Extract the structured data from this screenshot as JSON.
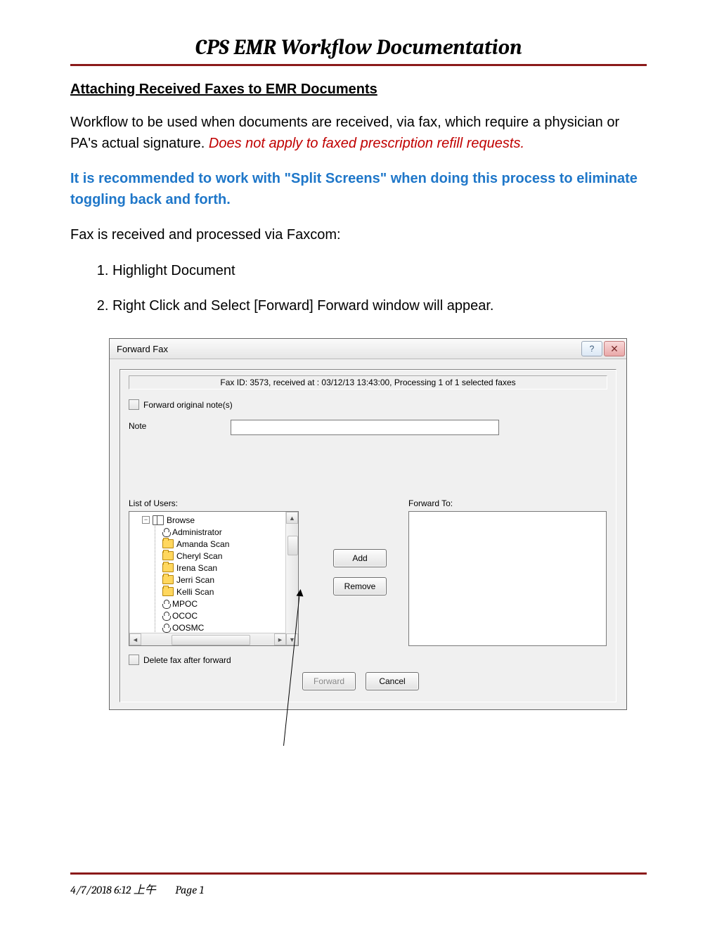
{
  "header": {
    "title": "CPS EMR Workflow Documentation"
  },
  "section": {
    "heading": "Attaching Received Faxes to EMR Documents"
  },
  "para1": {
    "lead": "Workflow to be used when documents are received, via fax, which require a physician or PA's actual signature. ",
    "warn": "Does not apply to faxed prescription refill requests."
  },
  "para2": "It is recommended to work with \"Split Screens\" when doing this process to eliminate toggling back and forth.",
  "para3": "Fax is received and processed via Faxcom:",
  "steps": [
    "Highlight Document",
    "Right Click and Select [Forward] Forward window will appear."
  ],
  "dialog": {
    "title": "Forward Fax",
    "help_glyph": "?",
    "close_glyph": "✕",
    "fax_id_line": "Fax ID: 3573, received at : 03/12/13 13:43:00, Processing  1 of 1 selected faxes",
    "forward_original_label": "Forward original note(s)",
    "note_label": "Note",
    "list_of_users_label": "List of Users:",
    "forward_to_label": "Forward To:",
    "tree_root": "Browse",
    "tree_items": [
      {
        "label": "Administrator",
        "icon": "user"
      },
      {
        "label": "Amanda Scan",
        "icon": "folder"
      },
      {
        "label": "Cheryl Scan",
        "icon": "folder"
      },
      {
        "label": "Irena Scan",
        "icon": "folder"
      },
      {
        "label": "Jerri Scan",
        "icon": "folder"
      },
      {
        "label": "Kelli Scan",
        "icon": "folder"
      },
      {
        "label": "MPOC",
        "icon": "user"
      },
      {
        "label": "OCOC",
        "icon": "user"
      },
      {
        "label": "OOSMC",
        "icon": "user"
      }
    ],
    "add_btn": "Add",
    "remove_btn": "Remove",
    "delete_after_label": "Delete fax after forward",
    "forward_btn": "Forward",
    "cancel_btn": "Cancel"
  },
  "footer": {
    "timestamp": "4/7/2018 6:12 上午",
    "page_label": "Page 1"
  }
}
